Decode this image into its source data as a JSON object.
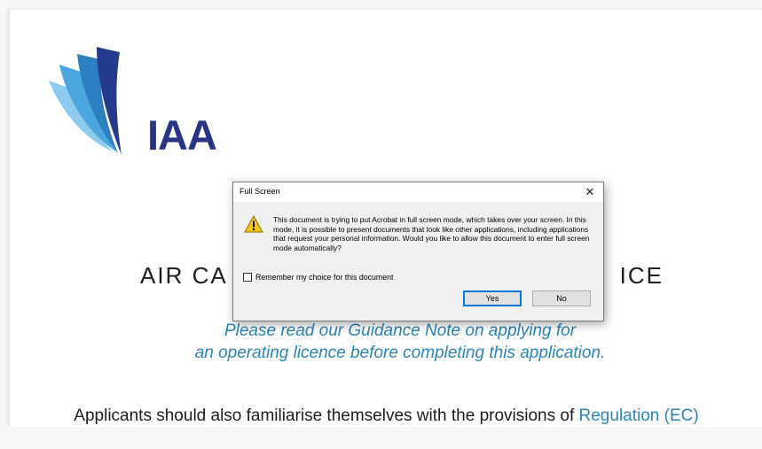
{
  "document": {
    "logo_text": "IAA",
    "title_left": "AIR CA",
    "title_right": "ICE",
    "guidance_line1": "Please read our Guidance Note on applying for",
    "guidance_line2": "an operating licence before completing this application.",
    "applicants_text": "Applicants should also familiarise themselves with the provisions of ",
    "regulation_link": "Regulation (EC)"
  },
  "dialog": {
    "title": "Full Screen",
    "close_glyph": "✕",
    "message": "This document is trying to put Acrobat in full screen mode, which takes over your screen. In this mode, it is possible to present documents that look like other applications, including applications that request your personal information. Would you like to allow this document to enter full screen mode automatically?",
    "remember_label": "Remember my choice for this document",
    "remember_checked": false,
    "yes_label": "Yes",
    "no_label": "No",
    "icon": "warning-icon"
  },
  "colors": {
    "logo_navy": "#2a3487",
    "logo_blue": "#2c7fc0",
    "logo_light": "#5fb3e3",
    "link_blue": "#2d84b7",
    "warning_yellow": "#f5c518"
  }
}
